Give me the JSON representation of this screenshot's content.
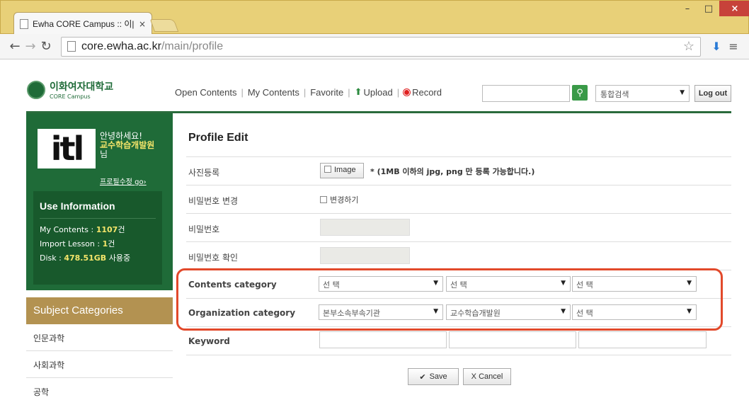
{
  "browser": {
    "tab_title": "Ewha CORE Campus :: 이|",
    "tab_close": "×",
    "url_host": "core.ewha.ac.kr",
    "url_path": "/main/profile",
    "window_controls": {
      "minimize": "–",
      "maximize": "□",
      "close": "×"
    }
  },
  "header": {
    "logo_korean": "이화여자대학교",
    "logo_english": "CORE Campus",
    "nav": [
      "Open Contents",
      "My Contents",
      "Favorite",
      "Upload",
      "Record"
    ],
    "search_select": "통합검색",
    "logout_label": "Log out"
  },
  "sidebar": {
    "avatar_text": "itl",
    "greeting": "안녕하세요!",
    "user_name": "교수학습개발원",
    "user_suffix": "님",
    "profile_edit_link": "프로필수정 go›",
    "use_info_title": "Use Information",
    "my_contents_label": "My Contents : ",
    "my_contents_value": "1107",
    "my_contents_unit": "건",
    "import_label": "Import Lesson : ",
    "import_value": "1",
    "import_unit": "건",
    "disk_label": "Disk : ",
    "disk_value": "478.51GB",
    "disk_unit": " 사용중",
    "subject_title": "Subject Categories",
    "subjects": [
      "인문과학",
      "사회과학",
      "공학"
    ]
  },
  "form": {
    "title": "Profile Edit",
    "photo_label": "사진등록",
    "image_button": "Image",
    "image_note": "* (1MB 이하의 jpg, png 만 등록 가능합니다.)",
    "pw_change_label": "비밀번호 변경",
    "pw_change_checkbox": "변경하기",
    "password_label": "비밀번호",
    "password_confirm_label": "비밀번호 확인",
    "contents_category_label": "Contents category",
    "contents_category": [
      "선 택",
      "선 택",
      "선 택"
    ],
    "organization_category_label": "Organization category",
    "organization_category": [
      "본부소속부속기관",
      "교수학습개발원",
      "선 택"
    ],
    "keyword_label": "Keyword",
    "save_label": "Save",
    "cancel_label": "X Cancel"
  },
  "colors": {
    "brand_green": "#1f6b38",
    "highlight_red": "#e2492b",
    "subject_gold": "#b39251",
    "accent_yellow": "#f4e56a"
  }
}
